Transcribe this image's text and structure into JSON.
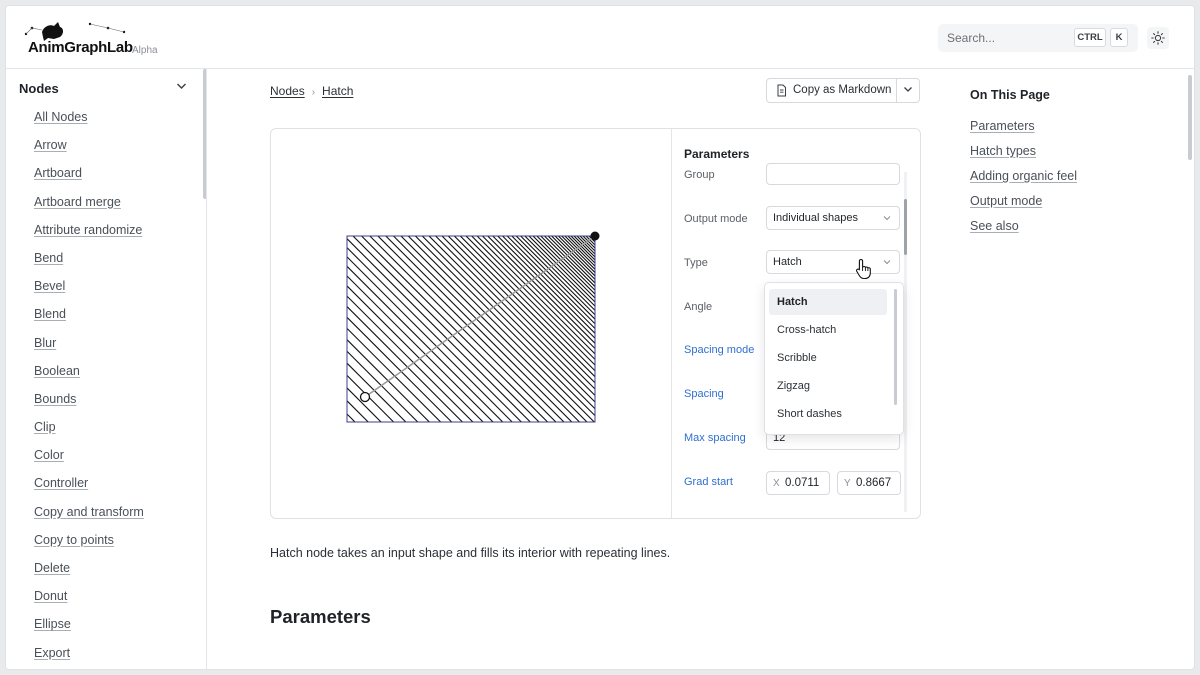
{
  "brand": {
    "name": "AnimGraphLab",
    "badge": "Alpha"
  },
  "search": {
    "placeholder": "Search...",
    "shortcut_ctrl": "CTRL",
    "shortcut_key": "K"
  },
  "icons": {
    "theme": "sun-icon",
    "copy": "file-icon",
    "cursor": "hand-pointer-icon"
  },
  "colors": {
    "accent_link": "#2f6fd1",
    "active_item_bg": "#eef0f3"
  },
  "sidebar": {
    "section_title": "Nodes",
    "items": [
      "All Nodes",
      "Arrow",
      "Artboard",
      "Artboard merge",
      "Attribute randomize",
      "Bend",
      "Bevel",
      "Blend",
      "Blur",
      "Boolean",
      "Bounds",
      "Clip",
      "Color",
      "Controller",
      "Copy and transform",
      "Copy to points",
      "Delete",
      "Donut",
      "Ellipse",
      "Export"
    ]
  },
  "breadcrumb": {
    "root": "Nodes",
    "current": "Hatch"
  },
  "copy_button": {
    "label": "Copy as Markdown"
  },
  "params_panel": {
    "title": "Parameters",
    "group_label": "Group",
    "output_mode": {
      "label": "Output mode",
      "value": "Individual shapes"
    },
    "type": {
      "label": "Type",
      "value": "Hatch"
    },
    "angle_label": "Angle",
    "spacing_mode_label": "Spacing mode",
    "spacing_label": "Spacing",
    "max_spacing": {
      "label": "Max spacing",
      "value": "12"
    },
    "grad_start": {
      "label": "Grad start",
      "x_tag": "X",
      "x_value": "0.0711",
      "y_tag": "Y",
      "y_value": "0.8667"
    }
  },
  "type_dropdown": {
    "options": [
      "Hatch",
      "Cross-hatch",
      "Scribble",
      "Zigzag",
      "Short dashes"
    ],
    "selected": "Hatch"
  },
  "content": {
    "intro": "Hatch node takes an input shape and fills its interior with repeating lines.",
    "heading": "Parameters"
  },
  "toc": {
    "title": "On This Page",
    "items": [
      "Parameters",
      "Hatch types",
      "Adding organic feel",
      "Output mode",
      "See also"
    ]
  }
}
